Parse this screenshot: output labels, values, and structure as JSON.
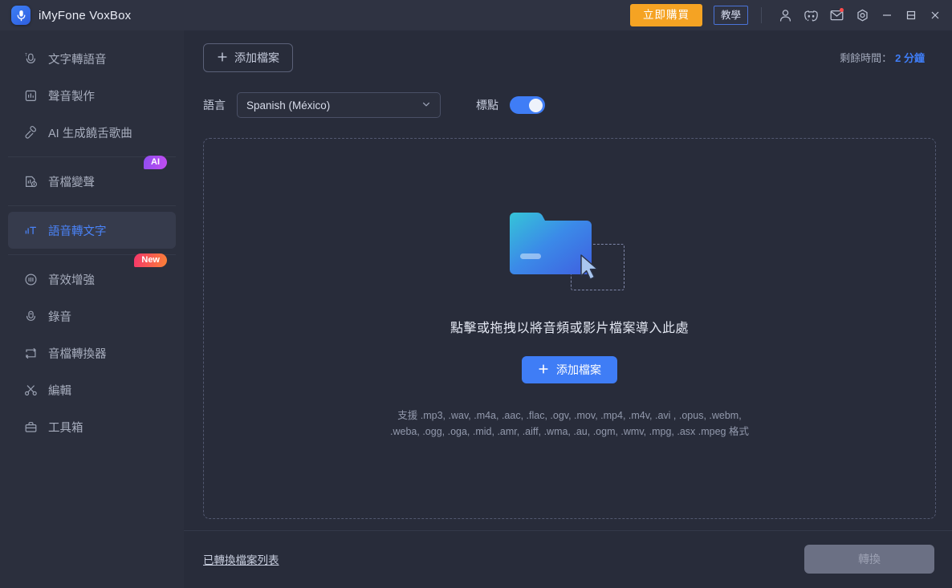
{
  "window": {
    "app_title": "iMyFone VoxBox",
    "logo_icon": "microphone-logo-icon",
    "buy_button": "立即購買",
    "tutorial_button": "教學",
    "icons": [
      {
        "name": "account-icon",
        "glyph": "person"
      },
      {
        "name": "discord-icon",
        "glyph": "discord"
      },
      {
        "name": "mail-icon",
        "glyph": "envelope",
        "has_badge": true
      },
      {
        "name": "settings-icon",
        "glyph": "target"
      }
    ],
    "controls": {
      "minimize": "minimize-icon",
      "maximize": "maximize-icon",
      "close": "close-icon"
    }
  },
  "sidebar": {
    "items": [
      {
        "label": "文字轉語音",
        "icon": "text-to-speech-icon",
        "active": false,
        "badge": null
      },
      {
        "label": "聲音製作",
        "icon": "voice-studio-icon",
        "active": false,
        "badge": null
      },
      {
        "label": "AI 生成饒舌歌曲",
        "icon": "ai-rap-song-icon",
        "active": false,
        "badge": null
      },
      {
        "label": "音檔變聲",
        "icon": "voice-changer-icon",
        "active": false,
        "badge": "AI"
      },
      {
        "label": "語音轉文字",
        "icon": "speech-to-text-icon",
        "active": true,
        "badge": null
      },
      {
        "label": "音效增強",
        "icon": "audio-enhance-icon",
        "active": false,
        "badge": "New"
      },
      {
        "label": "錄音",
        "icon": "recorder-icon",
        "active": false,
        "badge": null
      },
      {
        "label": "音檔轉換器",
        "icon": "audio-converter-icon",
        "active": false,
        "badge": null
      },
      {
        "label": "編輯",
        "icon": "scissors-edit-icon",
        "active": false,
        "badge": null
      },
      {
        "label": "工具箱",
        "icon": "toolbox-icon",
        "active": false,
        "badge": null
      }
    ]
  },
  "toolbar": {
    "add_file_outline_label": "添加檔案",
    "remaining_label": "剩餘時間：",
    "remaining_value": "2 分鐘",
    "language_label": "語言",
    "language_value": "Spanish (México)",
    "punctuation_label": "標點",
    "punctuation_on": true
  },
  "dropzone": {
    "hint": "點擊或拖拽以將音頻或影片檔案導入此處",
    "add_file_button": "添加檔案",
    "formats_line1": "支援 .mp3, .wav, .m4a, .aac, .flac, .ogv, .mov, .mp4, .m4v, .avi , .opus, .webm,",
    "formats_line2": ".weba, .ogg, .oga, .mid, .amr, .aiff, .wma, .au, .ogm, .wmv, .mpg, .asx .mpeg 格式"
  },
  "footer": {
    "converted_list_link": "已轉換檔案列表",
    "convert_button": "轉換",
    "convert_enabled": false
  },
  "colors": {
    "accent_blue": "#3f7df6",
    "buy_orange": "#f5a323",
    "badge_ai": "#a84df0",
    "badge_new": "#f5366b",
    "window_bg": "#282c3a",
    "sidebar_bg": "#2b2f3d",
    "titlebar_bg": "#2f3342"
  }
}
